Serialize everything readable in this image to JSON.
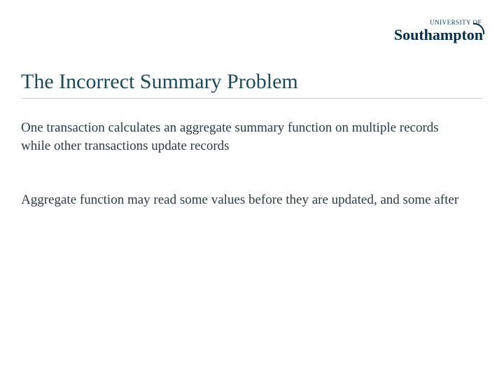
{
  "logo": {
    "top": "UNIVERSITY OF",
    "main": "Southampton"
  },
  "title": "The Incorrect Summary Problem",
  "body": {
    "p1": "One transaction calculates an aggregate summary function on multiple records while other transactions update records",
    "p2": "Aggregate function may read some values before they are updated, and some after"
  }
}
